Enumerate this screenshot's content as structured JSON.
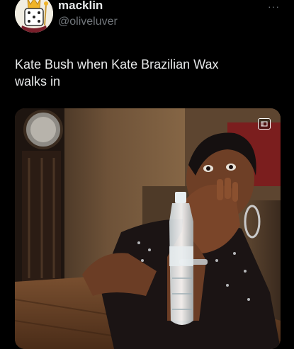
{
  "author": {
    "display_name": "macklin",
    "username": "@oliveluver",
    "avatar_icon": "dice-king-avatar-icon"
  },
  "more_icon": "more-options-icon",
  "tweet": {
    "text_line1": "Kate Bush when Kate Brazilian Wax",
    "text_line2": "walks in"
  },
  "media": {
    "type": "video",
    "badge_icon": "gif-badge-icon"
  },
  "colors": {
    "background": "#000000",
    "primary_text": "#e7e9ea",
    "secondary_text": "#71767b"
  }
}
